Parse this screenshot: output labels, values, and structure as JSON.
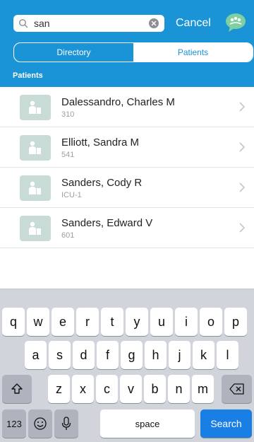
{
  "search": {
    "value": "san"
  },
  "header": {
    "cancel_label": "Cancel"
  },
  "tabs": [
    {
      "label": "Directory",
      "active": false
    },
    {
      "label": "Patients",
      "active": true
    }
  ],
  "section": {
    "title": "Patients"
  },
  "patients": [
    {
      "name": "Dalessandro, Charles M",
      "room": "310"
    },
    {
      "name": "Elliott, Sandra M",
      "room": "541"
    },
    {
      "name": "Sanders, Cody R",
      "room": "ICU-1"
    },
    {
      "name": "Sanders, Edward V",
      "room": "601"
    }
  ],
  "keyboard": {
    "row1": [
      "q",
      "w",
      "e",
      "r",
      "t",
      "y",
      "u",
      "i",
      "o",
      "p"
    ],
    "row2": [
      "a",
      "s",
      "d",
      "f",
      "g",
      "h",
      "j",
      "k",
      "l"
    ],
    "row3": [
      "z",
      "x",
      "c",
      "v",
      "b",
      "n",
      "m"
    ],
    "numbers_label": "123",
    "space_label": "space",
    "search_label": "Search"
  },
  "colors": {
    "accent": "#1a94d6",
    "search_key": "#1a7fe5"
  }
}
